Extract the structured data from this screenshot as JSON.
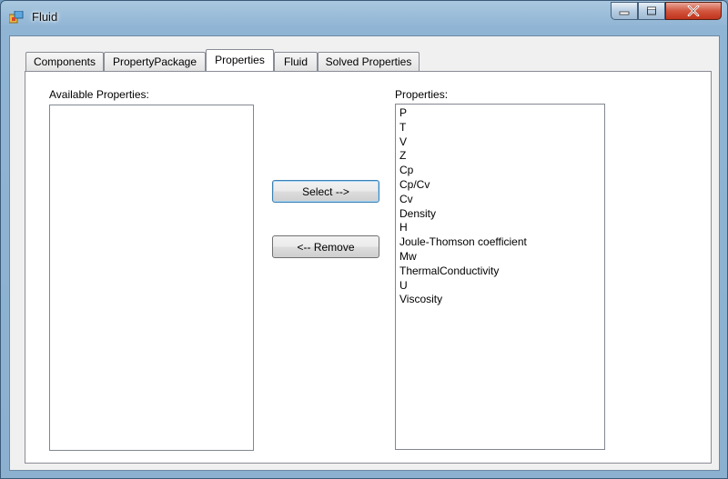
{
  "window": {
    "title": "Fluid",
    "controls": {
      "minimize": "—",
      "maximize": "☐",
      "close": "✕"
    }
  },
  "tabs": [
    {
      "label": "Components"
    },
    {
      "label": "PropertyPackage"
    },
    {
      "label": "Properties"
    },
    {
      "label": "Fluid"
    },
    {
      "label": "Solved Properties"
    }
  ],
  "active_tab": "Properties",
  "available": {
    "label": "Available Properties:",
    "items": []
  },
  "selected": {
    "label": "Properties:",
    "items": [
      "P",
      "T",
      "V",
      "Z",
      "Cp",
      "Cp/Cv",
      "Cv",
      "Density",
      "H",
      "Joule-Thomson coefficient",
      "Mw",
      "ThermalConductivity",
      "U",
      "Viscosity"
    ]
  },
  "buttons": {
    "select": "Select -->",
    "remove": "<-- Remove"
  },
  "colors": {
    "title_bar": "#8fb4d4",
    "close_button": "#c94a31",
    "panel": "#ffffff",
    "form": "#f0f0f0"
  }
}
